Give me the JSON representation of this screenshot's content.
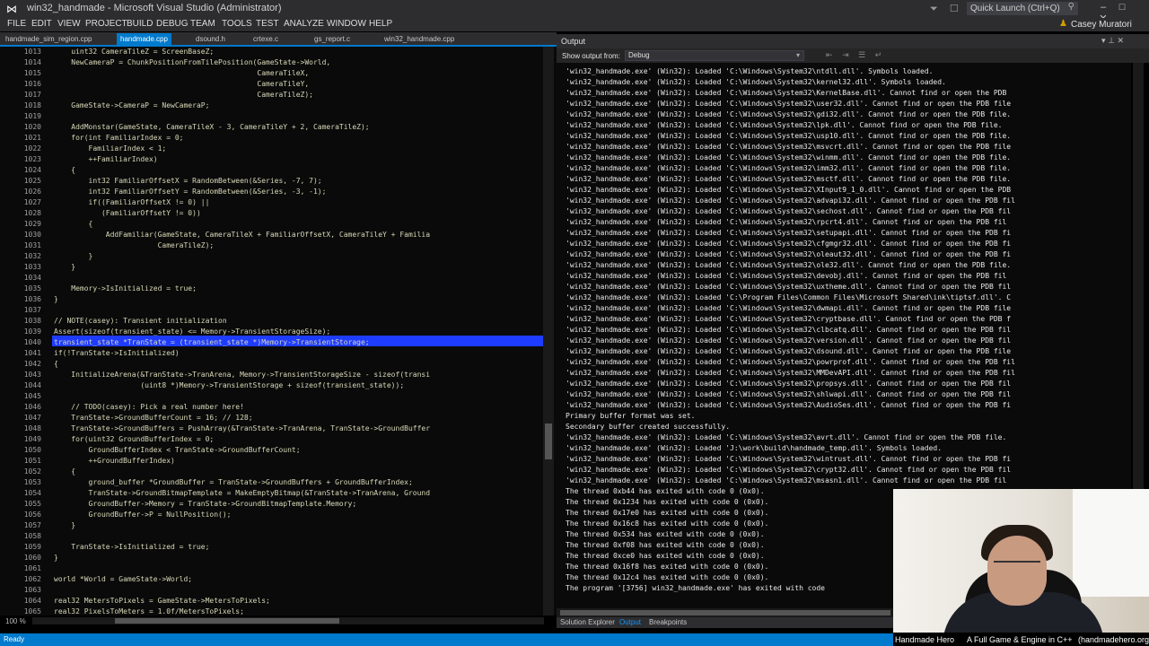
{
  "window": {
    "title": "win32_handmade - Microsoft Visual Studio (Administrator)",
    "quick_launch": "Quick Launch (Ctrl+Q)",
    "user": "Casey Muratori"
  },
  "menu": [
    "FILE",
    "EDIT",
    "VIEW",
    "PROJECT",
    "BUILD",
    "DEBUG",
    "TEAM",
    "TOOLS",
    "TEST",
    "ANALYZE",
    "WINDOW",
    "HELP"
  ],
  "editor": {
    "tabs": [
      "handmade_sim_region.cpp",
      "handmade.cpp",
      "dsound.h",
      "crtexe.c",
      "gs_report.c",
      "win32_handmade.cpp"
    ],
    "active_tab": "handmade.cpp",
    "zoom": "100 %",
    "lines": [
      {
        "n": "1013",
        "t": "    uint32 CameraTileZ = ScreenBaseZ;"
      },
      {
        "n": "1014",
        "t": "    NewCameraP = ChunkPositionFromTilePosition(GameState->World,"
      },
      {
        "n": "1015",
        "t": "                                               CameraTileX,"
      },
      {
        "n": "1016",
        "t": "                                               CameraTileY,"
      },
      {
        "n": "1017",
        "t": "                                               CameraTileZ);"
      },
      {
        "n": "1018",
        "t": "    GameState->CameraP = NewCameraP;"
      },
      {
        "n": "1019",
        "t": ""
      },
      {
        "n": "1020",
        "t": "    AddMonstar(GameState, CameraTileX - 3, CameraTileY + 2, CameraTileZ);"
      },
      {
        "n": "1021",
        "t": "    for(int FamiliarIndex = 0;"
      },
      {
        "n": "1022",
        "t": "        FamiliarIndex < 1;"
      },
      {
        "n": "1023",
        "t": "        ++FamiliarIndex)"
      },
      {
        "n": "1024",
        "t": "    {"
      },
      {
        "n": "1025",
        "t": "        int32 FamiliarOffsetX = RandomBetween(&Series, -7, 7);"
      },
      {
        "n": "1026",
        "t": "        int32 FamiliarOffsetY = RandomBetween(&Series, -3, -1);"
      },
      {
        "n": "1027",
        "t": "        if((FamiliarOffsetX != 0) ||"
      },
      {
        "n": "1028",
        "t": "           (FamiliarOffsetY != 0))"
      },
      {
        "n": "1029",
        "t": "        {"
      },
      {
        "n": "1030",
        "t": "            AddFamiliar(GameState, CameraTileX + FamiliarOffsetX, CameraTileY + Familia"
      },
      {
        "n": "1031",
        "t": "                        CameraTileZ);"
      },
      {
        "n": "1032",
        "t": "        }"
      },
      {
        "n": "1033",
        "t": "    }"
      },
      {
        "n": "1034",
        "t": ""
      },
      {
        "n": "1035",
        "t": "    Memory->IsInitialized = true;"
      },
      {
        "n": "1036",
        "t": "}"
      },
      {
        "n": "1037",
        "t": ""
      },
      {
        "n": "1038",
        "t": "// NOTE(casey): Transient initialization"
      },
      {
        "n": "1039",
        "t": "Assert(sizeof(transient_state) <= Memory->TransientStorageSize);"
      },
      {
        "n": "1040",
        "t": "transient_state *TranState = (transient_state *)Memory->TransientStorage;"
      },
      {
        "n": "1041",
        "t": "if(!TranState->IsInitialized)"
      },
      {
        "n": "1042",
        "t": "{"
      },
      {
        "n": "1043",
        "t": "    InitializeArena(&TranState->TranArena, Memory->TransientStorageSize - sizeof(transi"
      },
      {
        "n": "1044",
        "t": "                    (uint8 *)Memory->TransientStorage + sizeof(transient_state));"
      },
      {
        "n": "1045",
        "t": ""
      },
      {
        "n": "1046",
        "t": "    // TODO(casey): Pick a real number here!"
      },
      {
        "n": "1047",
        "t": "    TranState->GroundBufferCount = 16; // 128;"
      },
      {
        "n": "1048",
        "t": "    TranState->GroundBuffers = PushArray(&TranState->TranArena, TranState->GroundBuffer"
      },
      {
        "n": "1049",
        "t": "    for(uint32 GroundBufferIndex = 0;"
      },
      {
        "n": "1050",
        "t": "        GroundBufferIndex < TranState->GroundBufferCount;"
      },
      {
        "n": "1051",
        "t": "        ++GroundBufferIndex)"
      },
      {
        "n": "1052",
        "t": "    {"
      },
      {
        "n": "1053",
        "t": "        ground_buffer *GroundBuffer = TranState->GroundBuffers + GroundBufferIndex;"
      },
      {
        "n": "1054",
        "t": "        TranState->GroundBitmapTemplate = MakeEmptyBitmap(&TranState->TranArena, Ground"
      },
      {
        "n": "1055",
        "t": "        GroundBuffer->Memory = TranState->GroundBitmapTemplate.Memory;"
      },
      {
        "n": "1056",
        "t": "        GroundBuffer->P = NullPosition();"
      },
      {
        "n": "1057",
        "t": "    }"
      },
      {
        "n": "1058",
        "t": ""
      },
      {
        "n": "1059",
        "t": "    TranState->IsInitialized = true;"
      },
      {
        "n": "1060",
        "t": "}"
      },
      {
        "n": "1061",
        "t": ""
      },
      {
        "n": "1062",
        "t": "world *World = GameState->World;"
      },
      {
        "n": "1063",
        "t": ""
      },
      {
        "n": "1064",
        "t": "real32 MetersToPixels = GameState->MetersToPixels;"
      },
      {
        "n": "1065",
        "t": "real32 PixelsToMeters = 1.0f/MetersToPixels;"
      }
    ]
  },
  "output": {
    "title": "Output",
    "show_output_from": "Show output from:",
    "source": "Debug",
    "lines": [
      "'win32_handmade.exe' (Win32): Loaded 'C:\\Windows\\System32\\ntdll.dll'. Symbols loaded.",
      "'win32_handmade.exe' (Win32): Loaded 'C:\\Windows\\System32\\kernel32.dll'. Symbols loaded.",
      "'win32_handmade.exe' (Win32): Loaded 'C:\\Windows\\System32\\KernelBase.dll'. Cannot find or open the PDB",
      "'win32_handmade.exe' (Win32): Loaded 'C:\\Windows\\System32\\user32.dll'. Cannot find or open the PDB file",
      "'win32_handmade.exe' (Win32): Loaded 'C:\\Windows\\System32\\gdi32.dll'. Cannot find or open the PDB file.",
      "'win32_handmade.exe' (Win32): Loaded 'C:\\Windows\\System32\\lpk.dll'. Cannot find or open the PDB file.",
      "'win32_handmade.exe' (Win32): Loaded 'C:\\Windows\\System32\\usp10.dll'. Cannot find or open the PDB file.",
      "'win32_handmade.exe' (Win32): Loaded 'C:\\Windows\\System32\\msvcrt.dll'. Cannot find or open the PDB file",
      "'win32_handmade.exe' (Win32): Loaded 'C:\\Windows\\System32\\winmm.dll'. Cannot find or open the PDB file.",
      "'win32_handmade.exe' (Win32): Loaded 'C:\\Windows\\System32\\imm32.dll'. Cannot find or open the PDB file.",
      "'win32_handmade.exe' (Win32): Loaded 'C:\\Windows\\System32\\msctf.dll'. Cannot find or open the PDB file.",
      "'win32_handmade.exe' (Win32): Loaded 'C:\\Windows\\System32\\XInput9_1_0.dll'. Cannot find or open the PDB",
      "'win32_handmade.exe' (Win32): Loaded 'C:\\Windows\\System32\\advapi32.dll'. Cannot find or open the PDB fil",
      "'win32_handmade.exe' (Win32): Loaded 'C:\\Windows\\System32\\sechost.dll'. Cannot find or open the PDB fil",
      "'win32_handmade.exe' (Win32): Loaded 'C:\\Windows\\System32\\rpcrt4.dll'. Cannot find or open the PDB fil",
      "'win32_handmade.exe' (Win32): Loaded 'C:\\Windows\\System32\\setupapi.dll'. Cannot find or open the PDB fi",
      "'win32_handmade.exe' (Win32): Loaded 'C:\\Windows\\System32\\cfgmgr32.dll'. Cannot find or open the PDB fi",
      "'win32_handmade.exe' (Win32): Loaded 'C:\\Windows\\System32\\oleaut32.dll'. Cannot find or open the PDB fi",
      "'win32_handmade.exe' (Win32): Loaded 'C:\\Windows\\System32\\ole32.dll'. Cannot find or open the PDB file.",
      "'win32_handmade.exe' (Win32): Loaded 'C:\\Windows\\System32\\devobj.dll'. Cannot find or open the PDB fil",
      "'win32_handmade.exe' (Win32): Loaded 'C:\\Windows\\System32\\uxtheme.dll'. Cannot find or open the PDB fil",
      "'win32_handmade.exe' (Win32): Loaded 'C:\\Program Files\\Common Files\\Microsoft Shared\\ink\\tiptsf.dll'. C",
      "'win32_handmade.exe' (Win32): Loaded 'C:\\Windows\\System32\\dwmapi.dll'. Cannot find or open the PDB file",
      "'win32_handmade.exe' (Win32): Loaded 'C:\\Windows\\System32\\cryptbase.dll'. Cannot find or open the PDB f",
      "'win32_handmade.exe' (Win32): Loaded 'C:\\Windows\\System32\\clbcatq.dll'. Cannot find or open the PDB fil",
      "'win32_handmade.exe' (Win32): Loaded 'C:\\Windows\\System32\\version.dll'. Cannot find or open the PDB fil",
      "'win32_handmade.exe' (Win32): Loaded 'C:\\Windows\\System32\\dsound.dll'. Cannot find or open the PDB file",
      "'win32_handmade.exe' (Win32): Loaded 'C:\\Windows\\System32\\powrprof.dll'. Cannot find or open the PDB fil",
      "'win32_handmade.exe' (Win32): Loaded 'C:\\Windows\\System32\\MMDevAPI.dll'. Cannot find or open the PDB fil",
      "'win32_handmade.exe' (Win32): Loaded 'C:\\Windows\\System32\\propsys.dll'. Cannot find or open the PDB fil",
      "'win32_handmade.exe' (Win32): Loaded 'C:\\Windows\\System32\\shlwapi.dll'. Cannot find or open the PDB fil",
      "'win32_handmade.exe' (Win32): Loaded 'C:\\Windows\\System32\\AudioSes.dll'. Cannot find or open the PDB fi",
      "Primary buffer format was set.",
      "Secondary buffer created successfully.",
      "'win32_handmade.exe' (Win32): Loaded 'C:\\Windows\\System32\\avrt.dll'. Cannot find or open the PDB file.",
      "'win32_handmade.exe' (Win32): Loaded 'J:\\work\\build\\handmade_temp.dll'. Symbols loaded.",
      "'win32_handmade.exe' (Win32): Loaded 'C:\\Windows\\System32\\wintrust.dll'. Cannot find or open the PDB fi",
      "'win32_handmade.exe' (Win32): Loaded 'C:\\Windows\\System32\\crypt32.dll'. Cannot find or open the PDB fil",
      "'win32_handmade.exe' (Win32): Loaded 'C:\\Windows\\System32\\msasn1.dll'. Cannot find or open the PDB fil",
      "The thread 0xb44 has exited with code 0 (0x0).",
      "The thread 0x1234 has exited with code 0 (0x0).",
      "The thread 0x17e0 has exited with code 0 (0x0).",
      "The thread 0x16c8 has exited with code 0 (0x0).",
      "The thread 0x534 has exited with code 0 (0x0).",
      "The thread 0xf08 has exited with code 0 (0x0).",
      "The thread 0xce0 has exited with code 0 (0x0).",
      "The thread 0x16f8 has exited with code 0 (0x0).",
      "The thread 0x12c4 has exited with code 0 (0x0).",
      "The program '[3756] win32_handmade.exe' has exited with code"
    ]
  },
  "bottom_tabs": [
    "Solution Explorer",
    "Output",
    "Breakpoints"
  ],
  "active_bottom_tab": "Output",
  "status": "Ready",
  "banner": {
    "left": "Handmade Hero",
    "mid": "A Full Game & Engine in C++",
    "right": "(handmadehero.org)"
  }
}
